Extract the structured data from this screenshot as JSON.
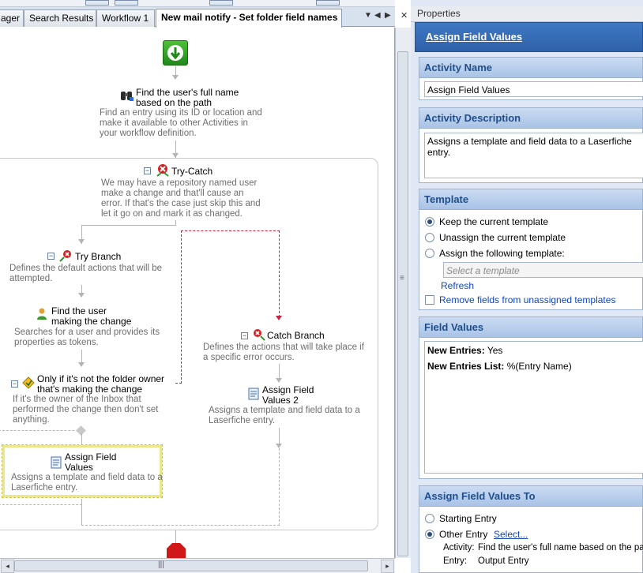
{
  "tabs": {
    "t1": "ager",
    "t2": "Search Results",
    "t3": "Workflow 1",
    "active": "New mail notify - Set folder field names",
    "ctl_dropdown": "▼",
    "ctl_prev": "◀",
    "ctl_next": "▶",
    "ctl_close": "✕"
  },
  "canvas": {
    "find_entry": {
      "title1": "Find the user's full name",
      "title2": "based on the path",
      "desc1": "Find an entry using its ID or location and",
      "desc2": "make it available to other Activities in",
      "desc3": "your workflow definition."
    },
    "try_catch": {
      "title": "Try-Catch",
      "desc1": "We may have a repository named user",
      "desc2": "make a change and that'll cause an",
      "desc3": "error. If that's the case just skip this and",
      "desc4": "let it go on and mark it as changed."
    },
    "try_branch": {
      "title": "Try Branch",
      "desc1": "Defines the default actions that will be",
      "desc2": "attempted."
    },
    "find_user": {
      "title1": "Find the user",
      "title2": "making the change",
      "desc1": "Searches for a user and provides its",
      "desc2": "properties as tokens."
    },
    "condition": {
      "title1": "Only if it's not the folder owner",
      "title2": "that's making the change",
      "desc1": "If it's the owner of the Inbox that",
      "desc2": "performed the change then don't set",
      "desc3": "anything."
    },
    "assign1": {
      "title1": "Assign Field",
      "title2": "Values",
      "desc1": "Assigns a template and field data to a",
      "desc2": "Laserfiche entry."
    },
    "catch_branch": {
      "title": "Catch Branch",
      "desc1": "Defines the actions that will take place if",
      "desc2": "a specific error occurs."
    },
    "assign2": {
      "title1": "Assign Field",
      "title2": "Values 2",
      "desc1": "Assigns a template and field data to a",
      "desc2": "Laserfiche entry."
    }
  },
  "scroll": {
    "grip": "|||",
    "vgrip": "≡"
  },
  "props": {
    "pane_title": "Properties",
    "header": "Assign Field Values",
    "activity_name": {
      "heading": "Activity Name",
      "value": "Assign Field Values"
    },
    "activity_desc": {
      "heading": "Activity Description",
      "value": "Assigns a template and field data to a Laserfiche entry."
    },
    "template": {
      "heading": "Template",
      "opt1": "Keep the current template",
      "opt2": "Unassign the current template",
      "opt3": "Assign the following template:",
      "placeholder": "Select a template",
      "refresh": "Refresh",
      "remove": "Remove fields from unassigned templates"
    },
    "field_values": {
      "heading": "Field Values",
      "row1_key": "New Entries:",
      "row1_val": "Yes",
      "row2_key": "New Entries List:",
      "row2_val": "%(Entry Name)"
    },
    "assign_to": {
      "heading": "Assign Field Values To",
      "opt1": "Starting Entry",
      "opt2": "Other Entry",
      "select": "Select...",
      "activity_key": "Activity:",
      "activity_val": "Find the user's full name based on the path",
      "entry_key": "Entry:",
      "entry_val": "Output Entry"
    }
  }
}
